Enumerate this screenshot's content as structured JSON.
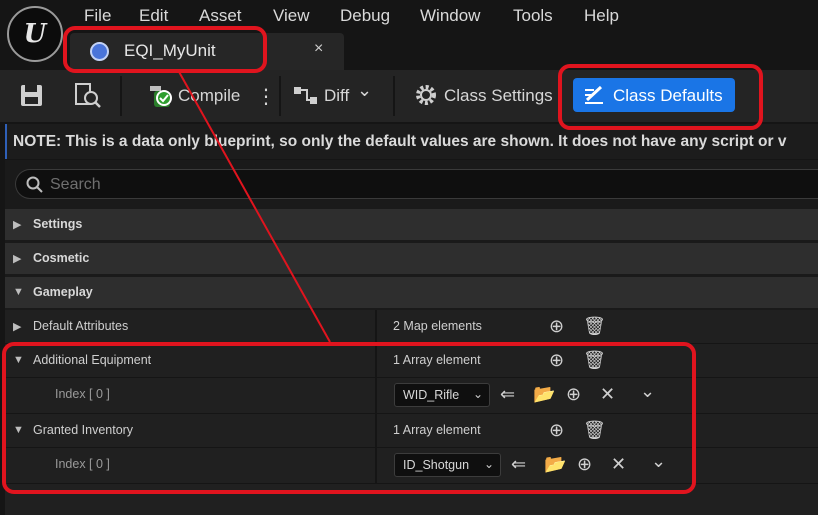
{
  "menu": [
    "File",
    "Edit",
    "Asset",
    "View",
    "Debug",
    "Window",
    "Tools",
    "Help"
  ],
  "logo_text": "U",
  "tab": {
    "title": "EQI_MyUnit",
    "close": "×"
  },
  "toolbar": {
    "save_icon": "save-icon",
    "browse_icon": "browse-icon",
    "compile_label": "Compile",
    "compile_menu": "⋮",
    "diff_label": "Diff",
    "diff_arrow": "⌄",
    "class_settings_label": "Class Settings",
    "class_defaults_label": "Class Defaults"
  },
  "note": "NOTE: This is a data only blueprint, so only the default values are shown.  It does not have any script or v",
  "search": {
    "placeholder": "Search"
  },
  "categories": {
    "settings": "Settings",
    "cosmetic": "Cosmetic",
    "gameplay": "Gameplay"
  },
  "properties": {
    "default_attributes": {
      "name": "Default Attributes",
      "value": "2 Map elements"
    },
    "additional_equipment": {
      "name": "Additional Equipment",
      "value": "1 Array element",
      "index_label": "Index [ 0 ]",
      "element_value": "WID_Rifle"
    },
    "granted_inventory": {
      "name": "Granted Inventory",
      "value": "1 Array element",
      "index_label": "Index [ 0 ]",
      "element_value": "ID_Shotgun"
    }
  },
  "colors": {
    "accent": "#1a75e6",
    "annotation": "#e0141e",
    "background": "#151515"
  }
}
